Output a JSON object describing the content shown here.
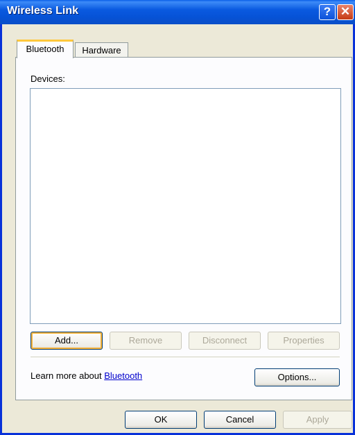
{
  "window": {
    "title": "Wireless Link"
  },
  "titlebar_buttons": {
    "help": "?",
    "close": "✕"
  },
  "tabs": [
    {
      "label": "Bluetooth",
      "active": true
    },
    {
      "label": "Hardware",
      "active": false
    }
  ],
  "devices": {
    "label": "Devices:",
    "items": []
  },
  "device_buttons": {
    "add": "Add...",
    "remove": "Remove",
    "disconnect": "Disconnect",
    "properties": "Properties"
  },
  "learn_more": {
    "text": "Learn more about ",
    "link": "Bluetooth"
  },
  "options_button": "Options...",
  "dialog_buttons": {
    "ok": "OK",
    "cancel": "Cancel",
    "apply": "Apply"
  }
}
